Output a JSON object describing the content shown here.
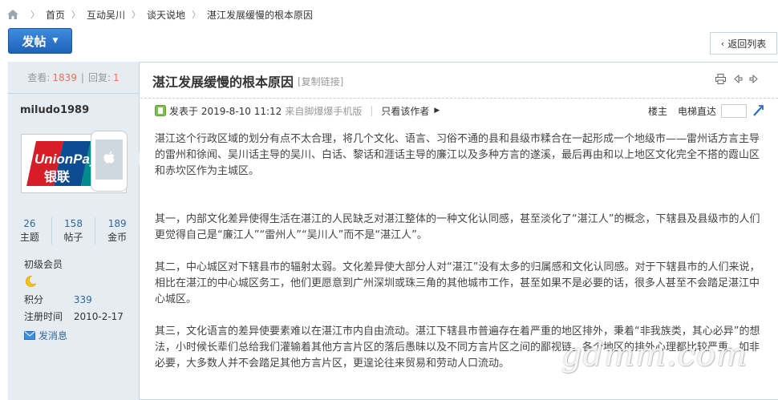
{
  "breadcrumb": {
    "items": [
      "首页",
      "互动吴川",
      "谈天说地",
      "湛江发展缓慢的根本原因"
    ]
  },
  "toolbar": {
    "post_label": "发帖",
    "back_label": "返回列表"
  },
  "thread_stats": {
    "views_label": "查看:",
    "views": "1839",
    "replies_label": "回复:",
    "replies": "1"
  },
  "author": {
    "name": "miludo1989",
    "topics": "26",
    "topics_label": "主题",
    "posts": "158",
    "posts_label": "帖子",
    "coins": "189",
    "coins_label": "金币",
    "level": "初级会员",
    "points_label": "积分",
    "points": "339",
    "reg_label": "注册时间",
    "reg_date": "2010-2-17",
    "message_label": "发消息",
    "avatar_text_top": "UnionPay",
    "avatar_text_bottom": "银联"
  },
  "post": {
    "title": "湛江发展缓慢的根本原因",
    "copy_link": "[复制链接]",
    "posted_at": "发表于 2019-8-10 11:12",
    "source": "来自脚爆爆手机版",
    "only_author": "只看该作者",
    "floor_label": "楼主",
    "direct_label": "电梯直达",
    "paragraphs": [
      "湛江这个行政区域的划分有点不太合理，将几个文化、语言、习俗不通的县和县级市糅合在一起形成一个地级市——雷州话方言主导的雷州和徐闻、吴川话主导的吴川、白话、黎话和涯话主导的廉江以及多种方言的遂溪，最后再由和以上地区文化完全不搭的霞山区和赤坎区作为主城区。",
      "",
      "其一，内部文化差异使得生活在湛江的人民缺乏对湛江整体的一种文化认同感，甚至淡化了“湛江人”的概念，下辖县及县级市的人们更觉得自己是“廉江人”“雷州人”“吴川人”而不是“湛江人”。",
      "其二，中心城区对下辖县市的辐射太弱。文化差异使大部分人对“湛江”没有太多的归属感和文化认同感。对于下辖县市的人们来说，相比在湛江的中心城区务工，他们更愿意到广州深圳或珠三角的其他城市工作，甚至如果不是必要的话，很多人甚至不会踏足湛江中心城区。",
      "其三，文化语言的差异使要素难以在湛江市内自由流动。湛江下辖县市普遍存在着严重的地区排外，秉着“非我族类，其心必异”的想法，小时候长辈们总给我们灌输着其他方言片区的落后愚昧以及不同方言片区之间的鄙视链。各个地区的排外心理都比较严重。如非必要，大多数人并不会踏足其他方言片区，更遑论往来贸易和劳动人口流动。"
    ]
  },
  "watermark": "gdmm.com",
  "colors": {
    "accent": "#1f63b8",
    "link": "#336699",
    "highlight": "#f26c4f",
    "sidebar_bg": "#e5edf2",
    "border": "#c2d5e3"
  }
}
